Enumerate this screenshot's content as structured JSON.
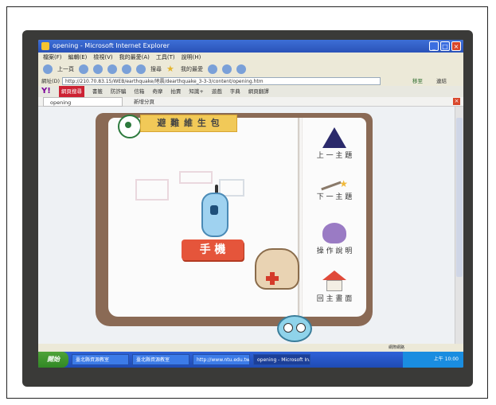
{
  "window": {
    "title": "opening - Microsoft Internet Explorer"
  },
  "menubar": {
    "items": [
      "檔案(F)",
      "編輯(E)",
      "檢視(V)",
      "我的最愛(A)",
      "工具(T)",
      "說明(H)"
    ]
  },
  "toolbar": {
    "back": "上一頁",
    "search": "搜尋",
    "favorites": "我的最愛"
  },
  "address": {
    "label": "網址(D)",
    "url": "http://210.70.83.15/WEB/earthquake/地震/dearthquake_3-3-3/content/opening.htm",
    "go": "移至",
    "links": "連結"
  },
  "yahoo_bar": {
    "logo": "Y!",
    "search_button": "網頁搜尋",
    "items": [
      "書籤",
      "防詐騙",
      "信箱",
      "奇摩",
      "拍賣",
      "知識+",
      "遊戲",
      "字典",
      "網頁翻譯"
    ]
  },
  "tabs": {
    "active": "opening",
    "new_tab": "新增分頁"
  },
  "book": {
    "title": "避 難 維 生 包",
    "item_label": "手 機",
    "menu": [
      {
        "label": "上 一 主 題",
        "icon": "wizard-hat-icon"
      },
      {
        "label": "下 一 主 題",
        "icon": "magic-wand-icon"
      },
      {
        "label": "操 作 說 明",
        "icon": "pouch-icon"
      },
      {
        "label": "回 主 畫 面",
        "icon": "house-icon"
      }
    ]
  },
  "statusbar": {
    "zone": "網際網路"
  },
  "taskbar": {
    "start": "開始",
    "items": [
      "臺北縣資源教室",
      "臺北縣資源教室",
      "http://www.ntu.edu.tw",
      "opening - Microsoft In..."
    ],
    "time": "上午 10:00"
  }
}
